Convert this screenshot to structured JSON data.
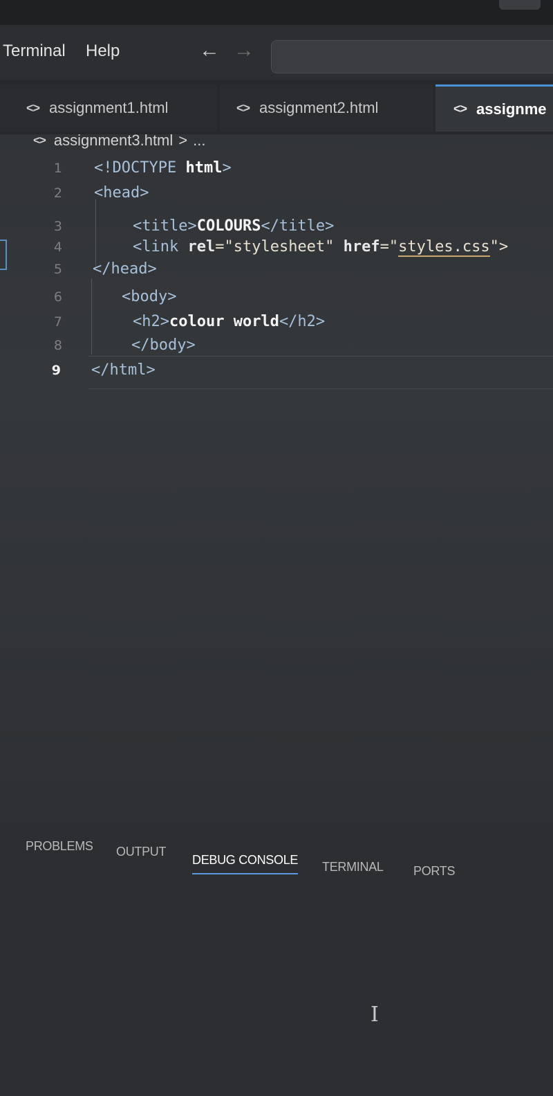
{
  "menubar": {
    "items": [
      "Terminal",
      "Help"
    ],
    "back_arrow": "←",
    "forward_arrow": "→"
  },
  "tabs": [
    {
      "icon": "<>",
      "label": "assignment1.html",
      "active": false
    },
    {
      "icon": "<>",
      "label": "assignment2.html",
      "active": false
    },
    {
      "icon": "<>",
      "label": "assignme",
      "active": true
    }
  ],
  "breadcrumb": {
    "icon": "<>",
    "file": "assignment3.html",
    "separator": ">",
    "more": "..."
  },
  "editor": {
    "line_numbers": [
      "1",
      "2",
      "3",
      "4",
      "5",
      "6",
      "7",
      "8",
      "9"
    ],
    "current_line": 9,
    "lines": [
      [
        {
          "t": "<!DOCTYPE ",
          "c": "tag"
        },
        {
          "t": "html",
          "c": "kw"
        },
        {
          "t": ">",
          "c": "tag"
        }
      ],
      [
        {
          "t": "<head>",
          "c": "tag"
        }
      ],
      [
        {
          "t": "<title>",
          "c": "tag"
        },
        {
          "t": "COLOURS",
          "c": "txt"
        },
        {
          "t": "</title>",
          "c": "tag"
        }
      ],
      [
        {
          "t": "<link ",
          "c": "tag"
        },
        {
          "t": "rel",
          "c": "attr"
        },
        {
          "t": "=\"stylesheet\" ",
          "c": "str"
        },
        {
          "t": "href",
          "c": "attr"
        },
        {
          "t": "=\"",
          "c": "str"
        },
        {
          "t": "styles.css",
          "c": "str under"
        },
        {
          "t": "\">",
          "c": "str"
        }
      ],
      [
        {
          "t": "</head>",
          "c": "tag"
        }
      ],
      [
        {
          "t": "<body>",
          "c": "tag"
        }
      ],
      [
        {
          "t": "<h2>",
          "c": "tag"
        },
        {
          "t": "colour world",
          "c": "txt"
        },
        {
          "t": "</h2>",
          "c": "tag"
        }
      ],
      [
        {
          "t": "</body>",
          "c": "tag"
        }
      ],
      [
        {
          "t": "</html>",
          "c": "tag"
        }
      ]
    ]
  },
  "panel": {
    "tabs": [
      "PROBLEMS",
      "OUTPUT",
      "DEBUG CONSOLE",
      "TERMINAL",
      "PORTS"
    ],
    "active_tab": "DEBUG CONSOLE",
    "cursor_glyph": "I"
  }
}
